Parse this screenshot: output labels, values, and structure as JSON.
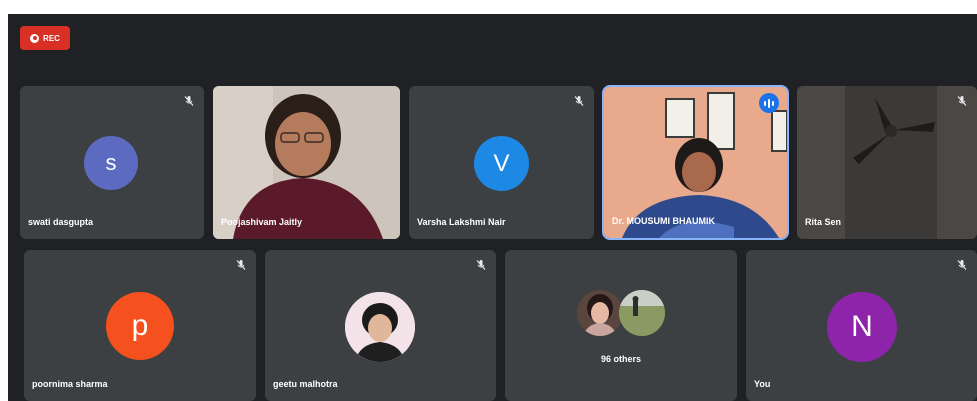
{
  "recording": {
    "label": "REC"
  },
  "participants": [
    {
      "name": "swati dasgupta",
      "initial": "s",
      "avatar_color": "#5c6bc0"
    },
    {
      "name": "Poojashivam Jaitly"
    },
    {
      "name": "Varsha Lakshmi Nair",
      "initial": "V",
      "avatar_color": "#1e88e5"
    },
    {
      "name": "Dr. MOUSUMI BHAUMIK"
    },
    {
      "name": "Rita Sen"
    },
    {
      "name": "poornima sharma",
      "initial": "p",
      "avatar_color": "#f4511e"
    },
    {
      "name": "geetu malhotra"
    },
    {
      "name": "96 others"
    },
    {
      "name": "You",
      "initial": "N",
      "avatar_color": "#8e24aa"
    }
  ],
  "colors": {
    "stage_background": "#202124",
    "tile_background": "#3c4043",
    "recording": "#d93025",
    "active_speaker_border": "#8ab4f8"
  },
  "icons": {
    "muted": "mic-off-icon",
    "speaking": "speaking-indicator-icon",
    "recording": "record-icon"
  }
}
